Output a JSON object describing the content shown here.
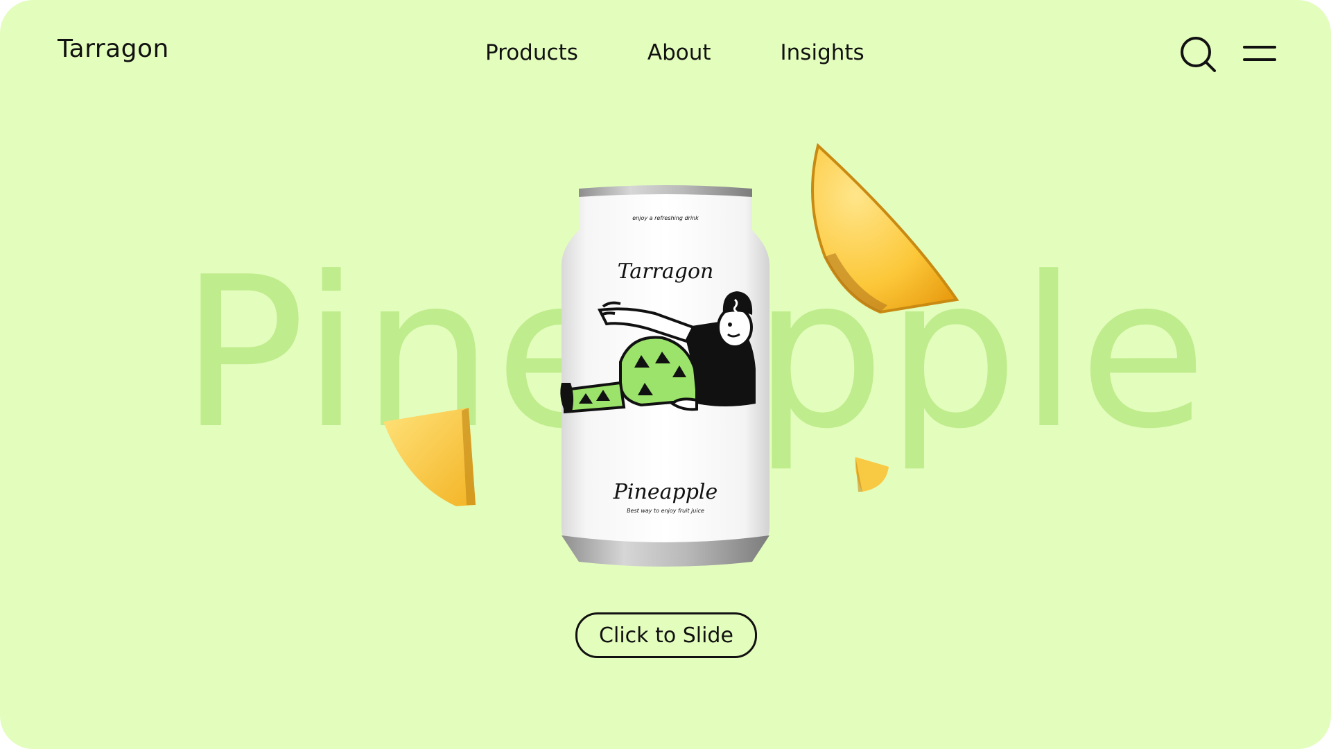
{
  "header": {
    "logo": "Tarragon",
    "nav": [
      "Products",
      "About",
      "Insights"
    ],
    "icons": [
      "search-icon",
      "menu-icon"
    ]
  },
  "hero": {
    "background_word": "Pineapple",
    "can": {
      "tagline": "enjoy a refreshing drink",
      "brand": "Tarragon",
      "flavor": "Pineapple",
      "subline": "Best way to enjoy fruit juice"
    },
    "cta_label": "Click to Slide"
  },
  "colors": {
    "background": "#e3fdbd",
    "hero_word": "#bfec8c",
    "text": "#111111",
    "accent_green": "#9be36a"
  }
}
